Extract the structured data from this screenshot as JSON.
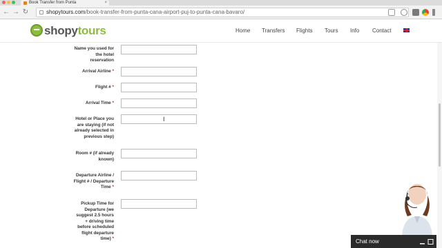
{
  "browser": {
    "tab_title": "Book Transfer from Punta",
    "url_host": "shopytours.com",
    "url_path": "/book-transfer-from-punta-cana-airport-puj-to-punta-cana-bavaro/"
  },
  "site": {
    "logo_shopy": "shopy",
    "logo_tours": "tours",
    "nav": [
      "Home",
      "Transfers",
      "Flights",
      "Tours",
      "Info",
      "Contact"
    ]
  },
  "form": {
    "rows": [
      {
        "label": "Name you used for the hotel reservation",
        "required": ""
      },
      {
        "label": "Arrival Airline",
        "required": "*"
      },
      {
        "label": "Flight #",
        "required": "*"
      },
      {
        "label": "Arrival Time",
        "required": "*"
      },
      {
        "label": "Hotel or Place you are staying (if not already selected in previous step)",
        "required": ""
      },
      {
        "label": "Room # (if already known)",
        "required": ""
      },
      {
        "label": "Departure Airline / Flight # / Departure Time",
        "required": "*"
      },
      {
        "label": "Pickup Time for Departure (we suggest 2.5 hours + driving time before scheduled flight departure time)",
        "required": "*"
      }
    ]
  },
  "chat": {
    "label": "Chat now"
  },
  "colors": {
    "brand_green": "#8cbd3f",
    "required_red": "#dd2222",
    "chat_bg": "#2b2b2b"
  }
}
